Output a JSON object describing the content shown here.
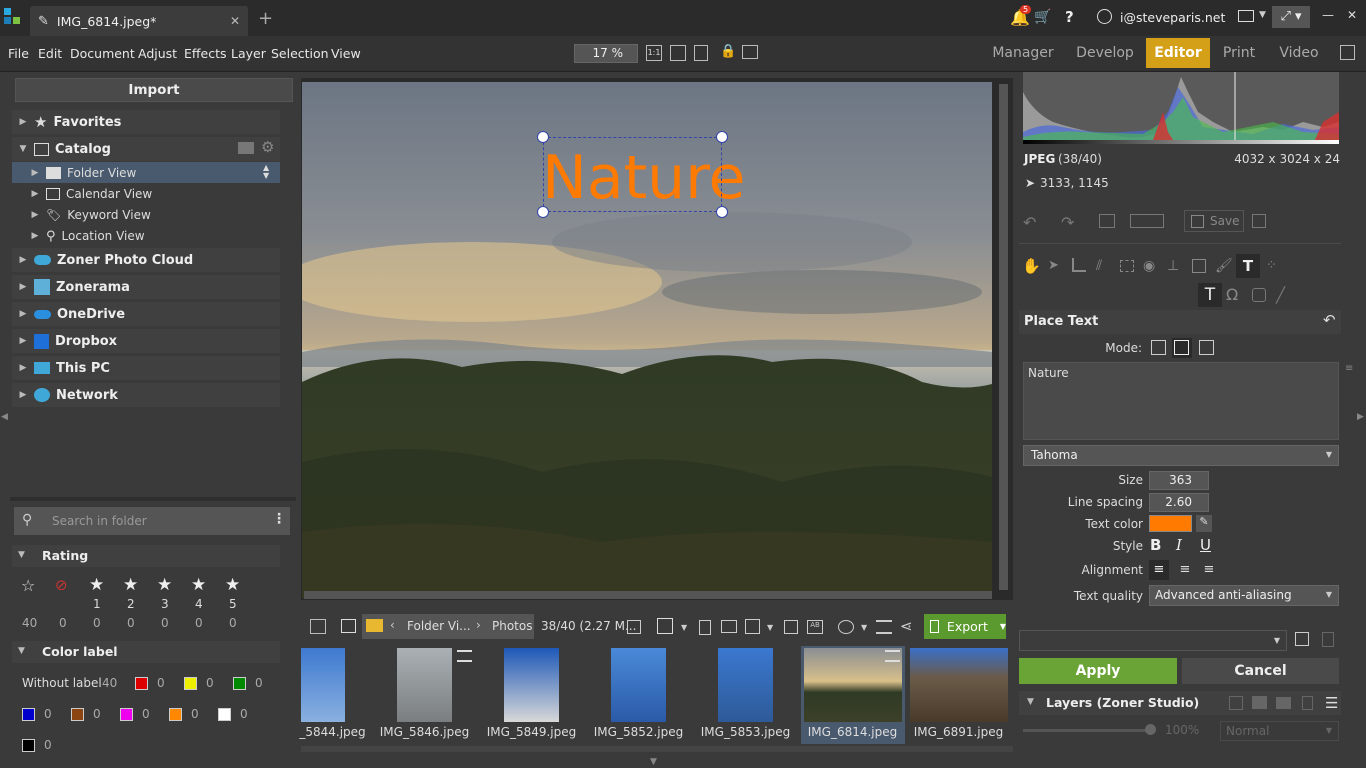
{
  "window": {
    "tab_title": "IMG_6814.jpeg*",
    "notification_count": "5",
    "user_email": "i@steveparis.net"
  },
  "menu": [
    "File",
    "Edit",
    "Document",
    "Adjust",
    "Effects",
    "Layer",
    "Selection",
    "View"
  ],
  "zoom": "17 %",
  "modes": {
    "manager": "Manager",
    "develop": "Develop",
    "editor": "Editor",
    "print": "Print",
    "video": "Video"
  },
  "left": {
    "import_label": "Import",
    "favorites": "Favorites",
    "catalog": "Catalog",
    "folder_view": "Folder View",
    "calendar_view": "Calendar View",
    "keyword_view": "Keyword View",
    "location_view": "Location View",
    "zoner_cloud": "Zoner Photo Cloud",
    "zonerama": "Zonerama",
    "onedrive": "OneDrive",
    "dropbox": "Dropbox",
    "this_pc": "This PC",
    "network": "Network",
    "search_placeholder": "Search in folder",
    "rating_title": "Rating",
    "rating_numbers": [
      "1",
      "2",
      "3",
      "4",
      "5"
    ],
    "rating_counts": [
      "40",
      "0",
      "0",
      "0",
      "0",
      "0",
      "0"
    ],
    "color_label_title": "Color label",
    "without_label": "Without label",
    "without_label_count": "40",
    "color_counts": [
      "0",
      "0",
      "0",
      "0",
      "0",
      "0",
      "0",
      "0",
      "0"
    ]
  },
  "canvas": {
    "text_overlay": "Nature"
  },
  "browser": {
    "path_1": "Folder Vi...",
    "path_2": "Photos",
    "count": "38/40 (2.27 M...",
    "export_label": "Export",
    "thumbnails": [
      "_5844.jpeg",
      "IMG_5846.jpeg",
      "IMG_5849.jpeg",
      "IMG_5852.jpeg",
      "IMG_5853.jpeg",
      "IMG_6814.jpeg",
      "IMG_6891.jpeg"
    ]
  },
  "right": {
    "format": "JPEG",
    "format_count": "(38/40)",
    "dimensions": "4032 x 3024 x 24",
    "cursor_pos": "3133, 1145",
    "save_label": "Save",
    "place_text_title": "Place Text",
    "mode_label": "Mode:",
    "text_value": "Nature",
    "font": "Tahoma",
    "size_label": "Size",
    "size_value": "363",
    "line_spacing_label": "Line spacing",
    "line_spacing_value": "2.60",
    "text_color_label": "Text color",
    "text_color": "#ff7a00",
    "style_label": "Style",
    "alignment_label": "Alignment",
    "text_quality_label": "Text quality",
    "text_quality_value": "Advanced anti-aliasing",
    "apply_label": "Apply",
    "cancel_label": "Cancel",
    "layers_title": "Layers (Zoner Studio)",
    "opacity": "100%",
    "blend": "Normal"
  },
  "colors": {
    "accent": "#d4a017",
    "apply_green": "#6aa336",
    "export_green": "#5a9a2e",
    "text_orange": "#ff7a00"
  }
}
